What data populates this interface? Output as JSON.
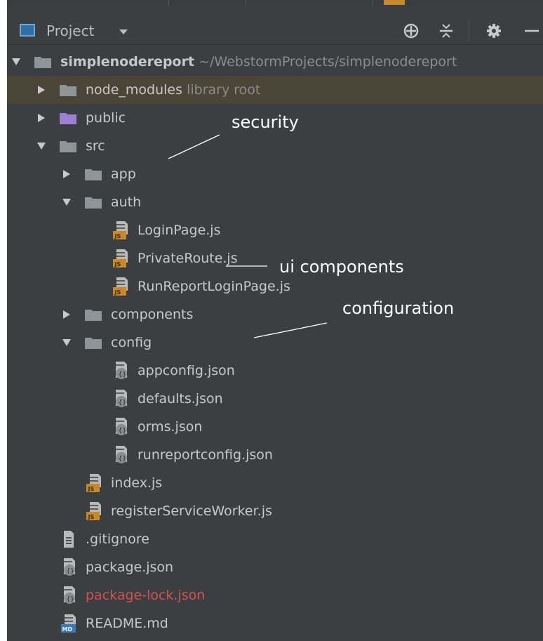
{
  "header": {
    "title": "Project",
    "icons": [
      "crosshair-icon",
      "collapse-icon",
      "gear-icon",
      "minimize-icon"
    ]
  },
  "tree": {
    "root": {
      "name": "simplenodereport",
      "hint": "~/WebstormProjects/simplenodereport"
    },
    "node_modules": {
      "name": "node_modules",
      "hint": "library root"
    },
    "public": "public",
    "src": "src",
    "app": "app",
    "auth": "auth",
    "auth_files": [
      "LoginPage.js",
      "PrivateRoute.js",
      "RunReportLoginPage.js"
    ],
    "components": "components",
    "config": "config",
    "config_files": [
      "appconfig.json",
      "defaults.json",
      "orms.json",
      "runreportconfig.json"
    ],
    "src_files": [
      "index.js",
      "registerServiceWorker.js"
    ],
    "root_files": [
      ".gitignore",
      "package.json",
      "package-lock.json",
      "README.md"
    ]
  },
  "annotations": {
    "security": "security",
    "ui_components": "ui components",
    "configuration": "configuration"
  },
  "colors": {
    "panel_bg": "#3c3f41",
    "selected_row": "#4a4537",
    "folder": "#8f9499",
    "folder_purple": "#9e7fd6",
    "text": "#c8c8c8",
    "hint": "#8c8c8c",
    "modified_file": "#d25252",
    "js_badge": "#c8892c"
  }
}
